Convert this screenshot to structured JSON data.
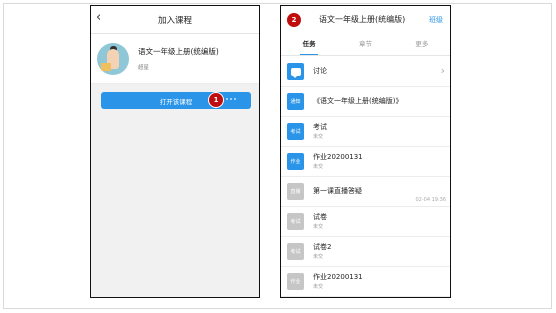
{
  "left_phone": {
    "header_title": "加入课程",
    "back_icon": "chevron-left-icon",
    "course": {
      "name": "语文一年级上册(统编版)",
      "teacher": "超星"
    },
    "open_button_label": "打开该课程",
    "step_number": "1"
  },
  "right_phone": {
    "step_number": "2",
    "title": "语文一年级上册(统编版)",
    "class_link": "班级",
    "tabs": [
      {
        "label": "任务"
      },
      {
        "label": "章节"
      },
      {
        "label": "更多"
      }
    ],
    "items": [
      {
        "icon_label": "",
        "icon": "chat-bubble-icon",
        "title": "讨论",
        "subtitle": "",
        "time": "",
        "color": "blue"
      },
      {
        "icon_label": "通知",
        "title": "《语文一年级上册(统编版)》",
        "subtitle": "",
        "time": "",
        "color": "blue"
      },
      {
        "icon_label": "考试",
        "title": "考试",
        "subtitle": "未交",
        "time": "",
        "color": "blue"
      },
      {
        "icon_label": "作业",
        "title": "作业20200131",
        "subtitle": "未交",
        "time": "",
        "color": "blue"
      },
      {
        "icon_label": "直播",
        "title": "第一课直播答疑",
        "subtitle": "",
        "time": "02-04 19:36",
        "color": "gray"
      },
      {
        "icon_label": "考试",
        "title": "试卷",
        "subtitle": "未交",
        "time": "",
        "color": "gray"
      },
      {
        "icon_label": "考试",
        "title": "试卷2",
        "subtitle": "未交",
        "time": "",
        "color": "gray"
      },
      {
        "icon_label": "作业",
        "title": "作业20200131",
        "subtitle": "未交",
        "time": "",
        "color": "gray"
      }
    ]
  },
  "colors": {
    "accent": "#2a95e8",
    "badge": "#c00d0d",
    "disabled_icon": "#c6c6c6"
  }
}
